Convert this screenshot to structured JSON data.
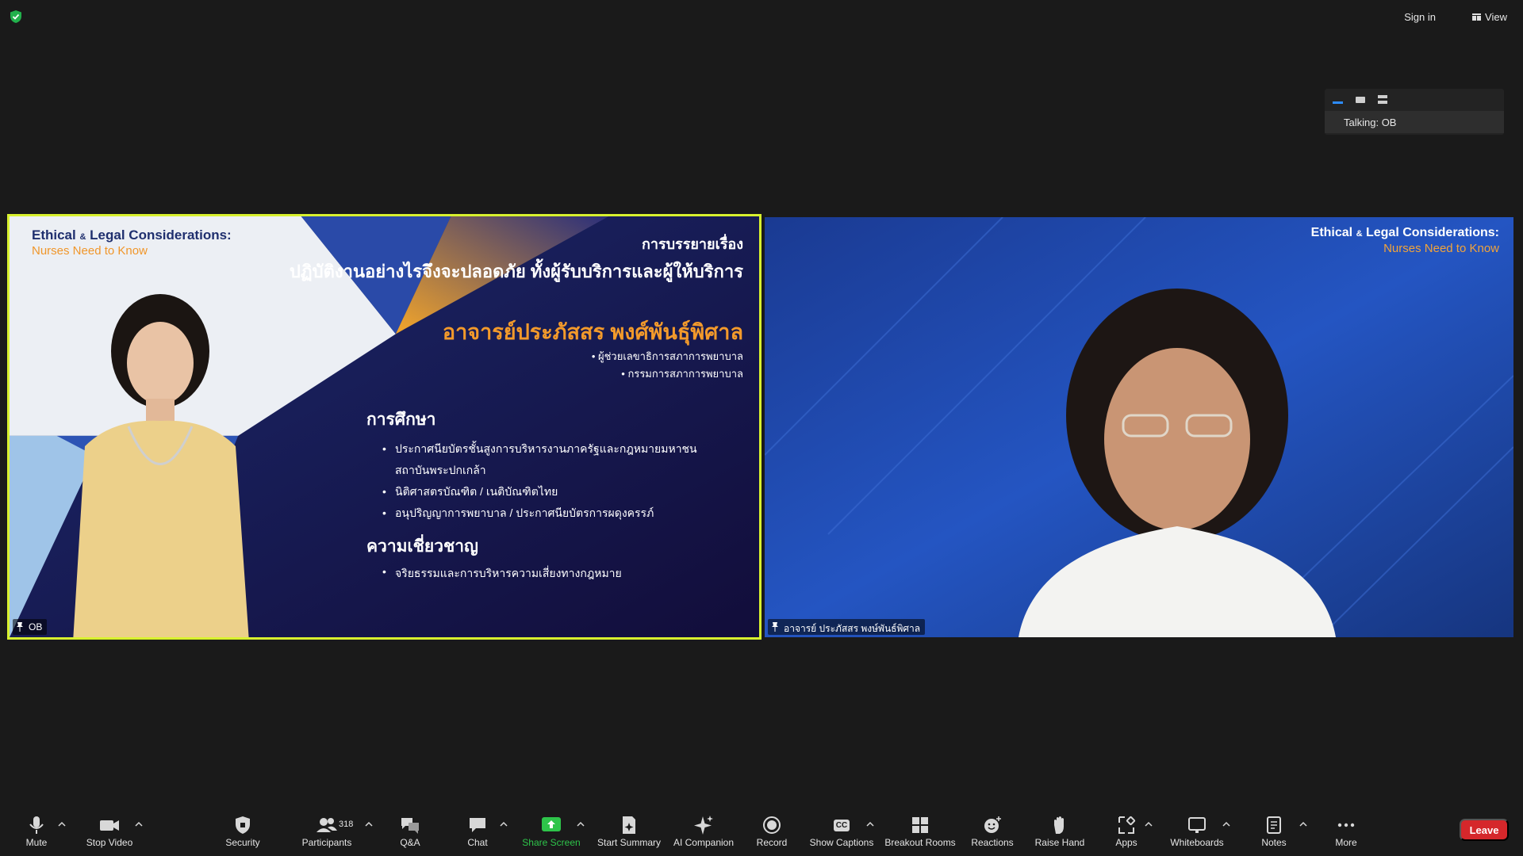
{
  "topbar": {
    "sign_in": "Sign in",
    "view": "View"
  },
  "talking_panel": {
    "label": "Talking: OB"
  },
  "left_tile": {
    "slide": {
      "title_en": "Ethical",
      "title_amp": "&",
      "title_en_rest": "Legal Considerations:",
      "subtitle_en": "Nurses Need to Know",
      "topic_label": "การบรรยายเรื่อง",
      "topic": "ปฏิบัติงานอย่างไรจึงจะปลอดภัย ทั้งผู้รับบริการและผู้ให้บริการ",
      "speaker_name": "อาจารย์ประภัสสร พงศ์พันธุ์พิศาล",
      "roles": [
        "ผู้ช่วยเลขาธิการสภาการพยาบาล",
        "กรรมการสภาการพยาบาล"
      ],
      "education_heading": "การศึกษา",
      "education": [
        "ประกาศนียบัตรชั้นสูงการบริหารงานภาครัฐและกฎหมายมหาชน",
        "สถาบันพระปกเกล้า",
        "นิติศาสตรบัณฑิต / เนติบัณฑิตไทย",
        "อนุปริญญาการพยาบาล / ประกาศนียบัตรการผดุงครรภ์"
      ],
      "expertise_heading": "ความเชี่ยวชาญ",
      "expertise": [
        "จริยธรรมและการบริหารความเสี่ยงทางกฎหมาย"
      ]
    },
    "name_tag": "OB"
  },
  "right_tile": {
    "title_en": "Ethical",
    "title_amp": "&",
    "title_en_rest": "Legal Considerations:",
    "subtitle_en": "Nurses Need to Know",
    "name_tag": "อาจารย์ ประภัสสร พงษ์พันธ์พิศาล"
  },
  "toolbar": {
    "mute": "Mute",
    "stop_video": "Stop Video",
    "security": "Security",
    "participants": "Participants",
    "participants_count": "318",
    "qa": "Q&A",
    "chat": "Chat",
    "share_screen": "Share Screen",
    "start_summary": "Start Summary",
    "ai_companion": "AI Companion",
    "record": "Record",
    "show_captions": "Show Captions",
    "cc_badge": "CC",
    "breakout_rooms": "Breakout Rooms",
    "reactions": "Reactions",
    "raise_hand": "Raise Hand",
    "apps": "Apps",
    "whiteboards": "Whiteboards",
    "notes": "Notes",
    "more": "More",
    "leave": "Leave"
  },
  "colors": {
    "active_speaker_border": "#d8f12e",
    "leave": "#d5272b",
    "share_green": "#2ec44a",
    "accent_blue": "#2d8cff"
  }
}
